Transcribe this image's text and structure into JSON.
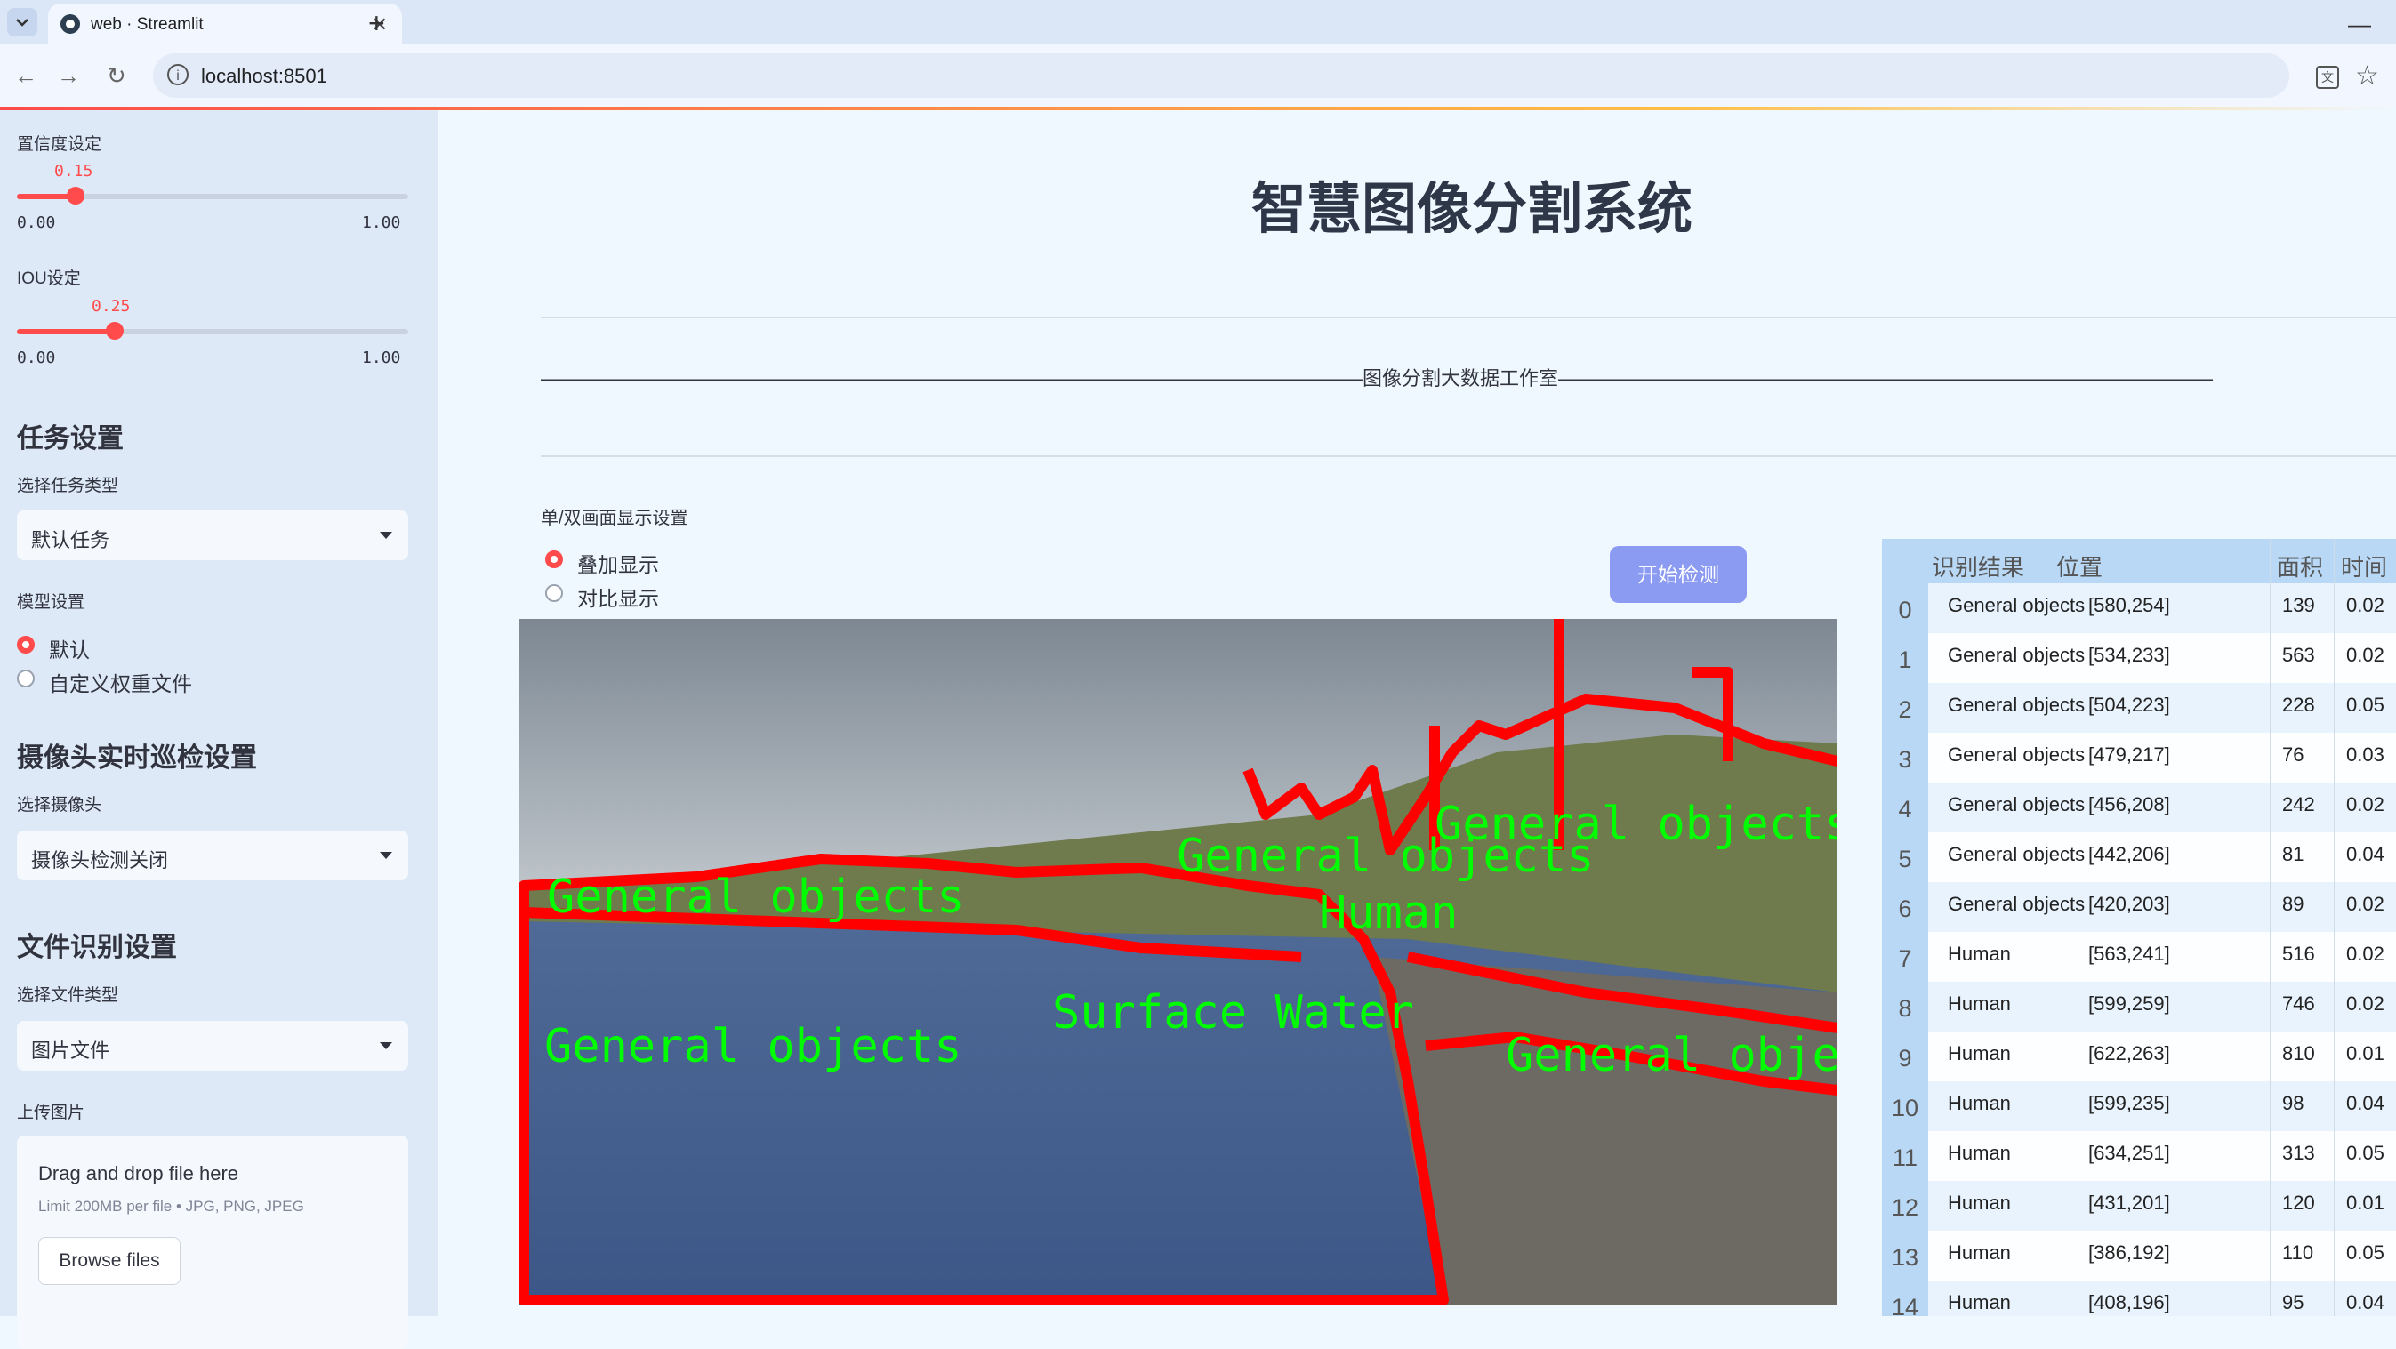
{
  "browser": {
    "tab_title": "web · Streamlit",
    "url": "localhost:8501"
  },
  "sidebar": {
    "conf_label": "置信度设定",
    "conf_value": "0.15",
    "conf_fraction": 0.15,
    "conf_min": "0.00",
    "conf_max": "1.00",
    "iou_label": "IOU设定",
    "iou_value": "0.25",
    "iou_fraction": 0.25,
    "iou_min": "0.00",
    "iou_max": "1.00",
    "task_heading": "任务设置",
    "task_type_label": "选择任务类型",
    "task_type_value": "默认任务",
    "model_label": "模型设置",
    "model_options": [
      "默认",
      "自定义权重文件"
    ],
    "model_selected": 0,
    "camera_heading": "摄像头实时巡检设置",
    "camera_label": "选择摄像头",
    "camera_value": "摄像头检测关闭",
    "file_heading": "文件识别设置",
    "file_type_label": "选择文件类型",
    "file_type_value": "图片文件",
    "upload_label": "上传图片",
    "upload_title": "Drag and drop file here",
    "upload_limit": "Limit 200MB per file • JPG, PNG, JPEG",
    "browse_label": "Browse files"
  },
  "main": {
    "title": "智慧图像分割系统",
    "studio_line": "——————————————————————————————————————————图像分割大数据工作室——————————————————————————————————————————",
    "display_label": "单/双画面显示设置",
    "display_options": [
      "叠加显示",
      "对比显示"
    ],
    "display_selected": 0,
    "start_button": "开始检测",
    "image_labels": [
      "General objects",
      "General objects",
      "General objects",
      "General objects",
      "Surface Water",
      "General objects",
      "Human"
    ]
  },
  "table": {
    "headers": [
      "识别结果",
      "位置",
      "面积",
      "时间"
    ],
    "rows": [
      {
        "idx": "0",
        "result": "General objects",
        "pos": "[580,254]",
        "area": "139",
        "time": "0.02"
      },
      {
        "idx": "1",
        "result": "General objects",
        "pos": "[534,233]",
        "area": "563",
        "time": "0.02"
      },
      {
        "idx": "2",
        "result": "General objects",
        "pos": "[504,223]",
        "area": "228",
        "time": "0.05"
      },
      {
        "idx": "3",
        "result": "General objects",
        "pos": "[479,217]",
        "area": "76",
        "time": "0.03"
      },
      {
        "idx": "4",
        "result": "General objects",
        "pos": "[456,208]",
        "area": "242",
        "time": "0.02"
      },
      {
        "idx": "5",
        "result": "General objects",
        "pos": "[442,206]",
        "area": "81",
        "time": "0.04"
      },
      {
        "idx": "6",
        "result": "General objects",
        "pos": "[420,203]",
        "area": "89",
        "time": "0.02"
      },
      {
        "idx": "7",
        "result": "Human",
        "pos": "[563,241]",
        "area": "516",
        "time": "0.02"
      },
      {
        "idx": "8",
        "result": "Human",
        "pos": "[599,259]",
        "area": "746",
        "time": "0.02"
      },
      {
        "idx": "9",
        "result": "Human",
        "pos": "[622,263]",
        "area": "810",
        "time": "0.01"
      },
      {
        "idx": "10",
        "result": "Human",
        "pos": "[599,235]",
        "area": "98",
        "time": "0.04"
      },
      {
        "idx": "11",
        "result": "Human",
        "pos": "[634,251]",
        "area": "313",
        "time": "0.05"
      },
      {
        "idx": "12",
        "result": "Human",
        "pos": "[431,201]",
        "area": "120",
        "time": "0.01"
      },
      {
        "idx": "13",
        "result": "Human",
        "pos": "[386,192]",
        "area": "110",
        "time": "0.05"
      },
      {
        "idx": "14",
        "result": "Human",
        "pos": "[408,196]",
        "area": "95",
        "time": "0.04"
      }
    ]
  },
  "colors": {
    "accent": "#ff4b4b",
    "button": "#8c9bf2",
    "sidebar_bg": "#dde9f6",
    "page_bg": "#f0f8ff",
    "mask_outline": "#ff0000",
    "label_text": "#00ff00"
  }
}
